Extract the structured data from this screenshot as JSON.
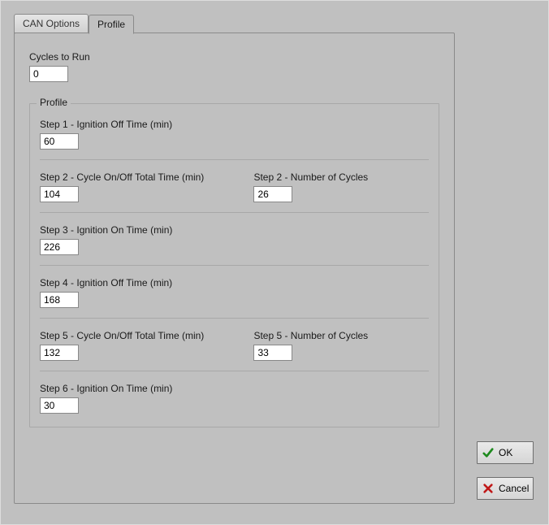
{
  "tabs": {
    "can_options": "CAN Options",
    "profile": "Profile"
  },
  "panel": {
    "cycles_label": "Cycles to Run",
    "cycles_value": "0",
    "profile_legend": "Profile",
    "steps": [
      {
        "left_label": "Step 1 - Ignition Off Time (min)",
        "left_value": "60",
        "right_label": "",
        "right_value": ""
      },
      {
        "left_label": "Step 2 - Cycle On/Off Total Time (min)",
        "left_value": "104",
        "right_label": "Step 2 - Number of Cycles",
        "right_value": "26"
      },
      {
        "left_label": "Step 3 - Ignition On Time (min)",
        "left_value": "226",
        "right_label": "",
        "right_value": ""
      },
      {
        "left_label": "Step 4 - Ignition Off Time (min)",
        "left_value": "168",
        "right_label": "",
        "right_value": ""
      },
      {
        "left_label": "Step 5 - Cycle On/Off Total Time (min)",
        "left_value": "132",
        "right_label": "Step 5 - Number of Cycles",
        "right_value": "33"
      },
      {
        "left_label": "Step 6 - Ignition On Time (min)",
        "left_value": "30",
        "right_label": "",
        "right_value": ""
      }
    ]
  },
  "buttons": {
    "ok": "OK",
    "cancel": "Cancel"
  }
}
